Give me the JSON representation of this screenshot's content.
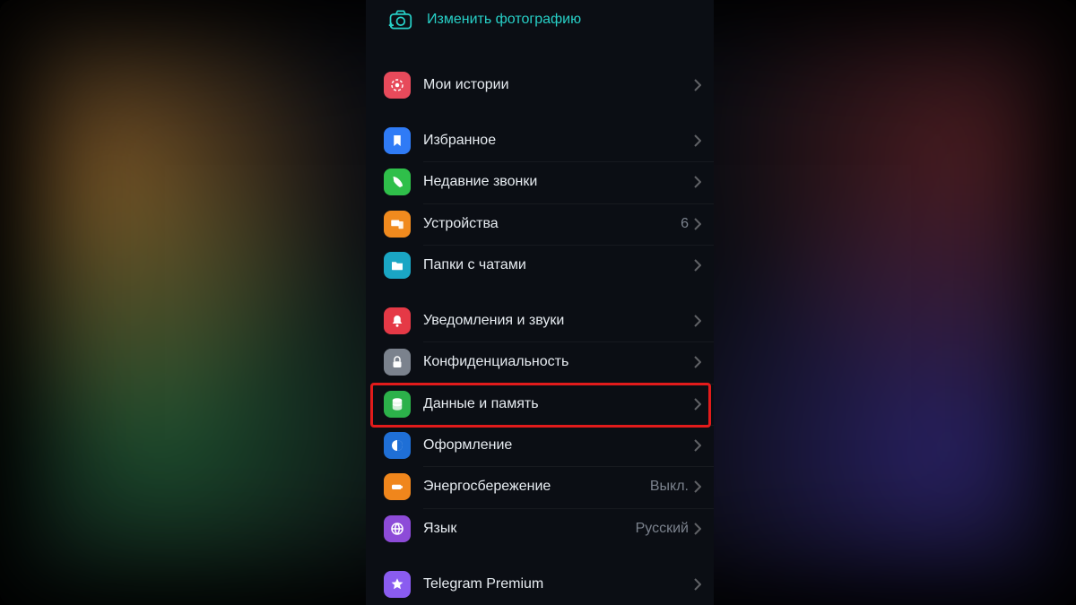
{
  "accent": "#27d0c7",
  "change_photo": {
    "label": "Изменить фотографию"
  },
  "groups": [
    {
      "rows": [
        {
          "key": "my_stories",
          "label": "Мои истории",
          "value": ""
        }
      ]
    },
    {
      "rows": [
        {
          "key": "saved",
          "label": "Избранное",
          "value": ""
        },
        {
          "key": "calls",
          "label": "Недавние звонки",
          "value": ""
        },
        {
          "key": "devices",
          "label": "Устройства",
          "value": "6"
        },
        {
          "key": "folders",
          "label": "Папки с чатами",
          "value": ""
        }
      ]
    },
    {
      "rows": [
        {
          "key": "notifications",
          "label": "Уведомления и звуки",
          "value": ""
        },
        {
          "key": "privacy",
          "label": "Конфиденциальность",
          "value": ""
        },
        {
          "key": "data",
          "label": "Данные и память",
          "value": "",
          "highlight": true
        },
        {
          "key": "appearance",
          "label": "Оформление",
          "value": ""
        },
        {
          "key": "power",
          "label": "Энергосбережение",
          "value": "Выкл."
        },
        {
          "key": "language",
          "label": "Язык",
          "value": "Русский"
        }
      ]
    },
    {
      "rows": [
        {
          "key": "premium",
          "label": "Telegram Premium",
          "value": ""
        }
      ]
    }
  ]
}
